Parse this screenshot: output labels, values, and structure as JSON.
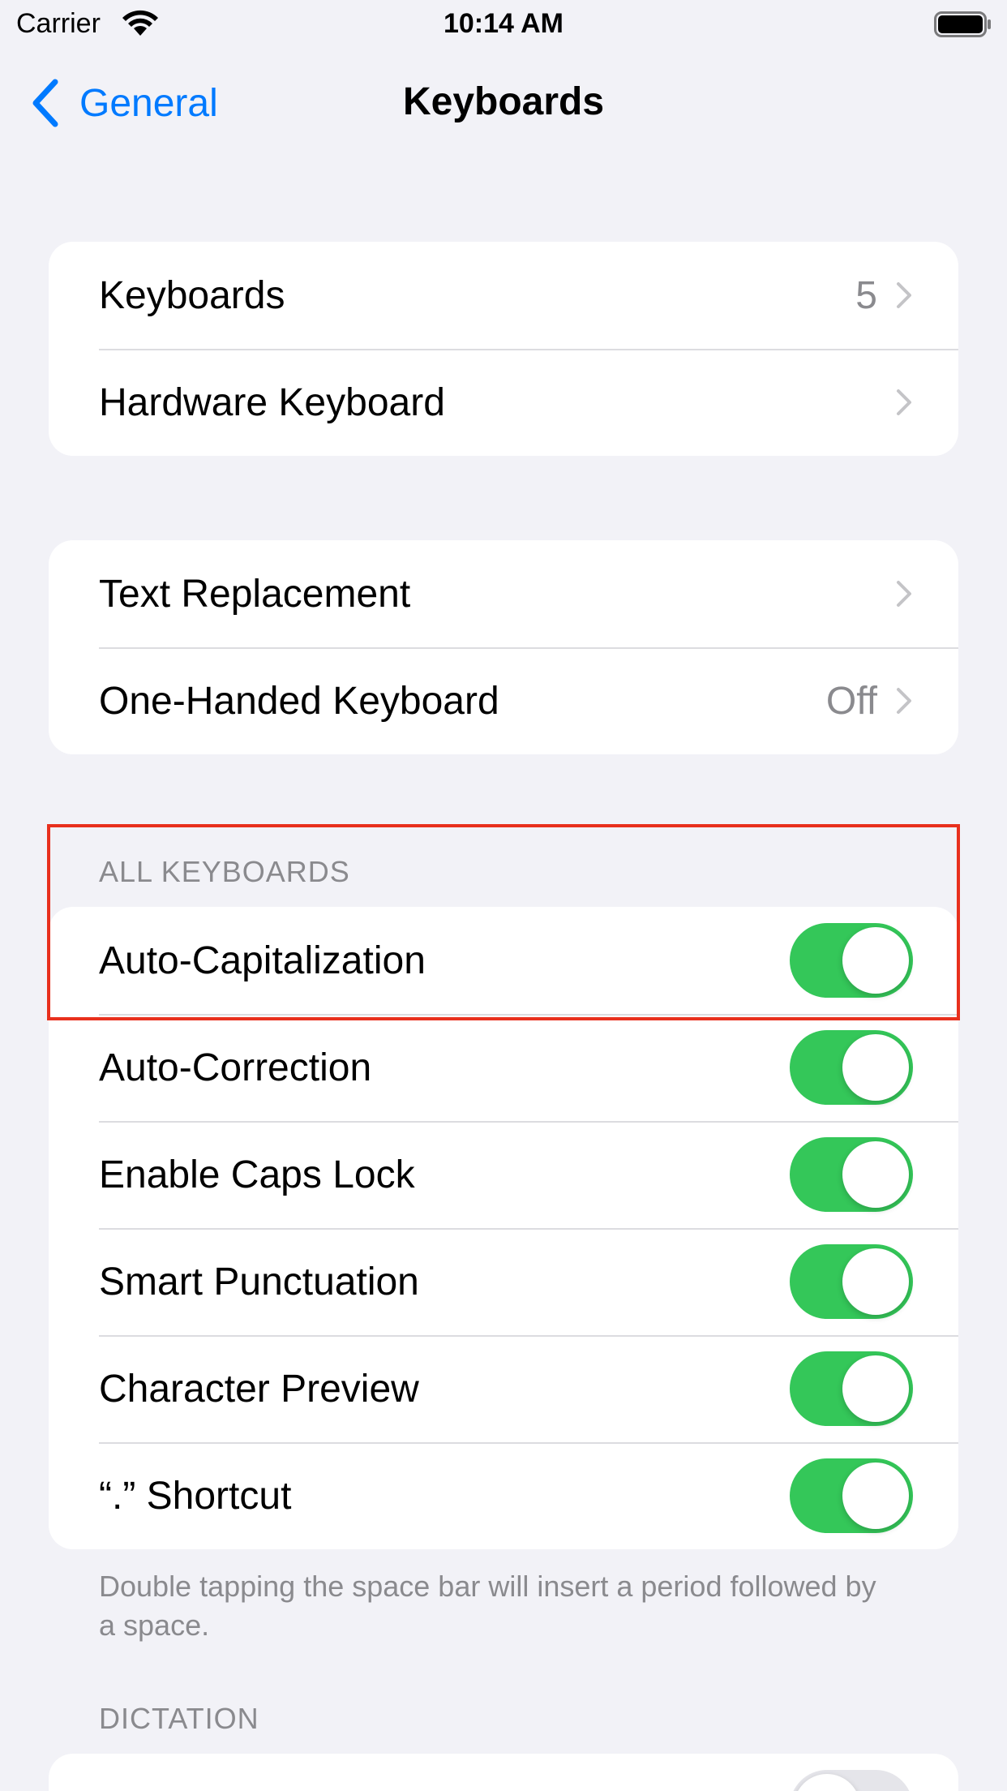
{
  "status_bar": {
    "carrier": "Carrier",
    "time": "10:14 AM"
  },
  "nav": {
    "back_label": "General",
    "title": "Keyboards"
  },
  "group1": {
    "rows": [
      {
        "label": "Keyboards",
        "value": "5"
      },
      {
        "label": "Hardware Keyboard",
        "value": ""
      }
    ]
  },
  "group2": {
    "rows": [
      {
        "label": "Text Replacement",
        "value": ""
      },
      {
        "label": "One-Handed Keyboard",
        "value": "Off"
      }
    ]
  },
  "all_keyboards": {
    "header": "ALL KEYBOARDS",
    "rows": [
      {
        "label": "Auto-Capitalization",
        "on": true
      },
      {
        "label": "Auto-Correction",
        "on": true
      },
      {
        "label": "Enable Caps Lock",
        "on": true
      },
      {
        "label": "Smart Punctuation",
        "on": true
      },
      {
        "label": "Character Preview",
        "on": true
      },
      {
        "label": "“.” Shortcut",
        "on": true
      }
    ],
    "footer": "Double tapping the space bar will insert a period followed by a space."
  },
  "dictation": {
    "header": "DICTATION",
    "toggle_on": false
  },
  "colors": {
    "accent": "#007aff",
    "toggle_on": "#34c759",
    "highlight": "#e8301d"
  }
}
